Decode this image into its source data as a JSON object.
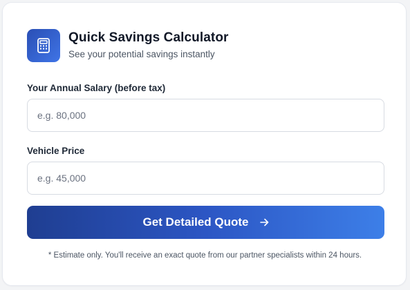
{
  "header": {
    "title": "Quick Savings Calculator",
    "subtitle": "See your potential savings instantly",
    "icon": "calculator-icon"
  },
  "form": {
    "salary": {
      "label": "Your Annual Salary (before tax)",
      "placeholder": "e.g. 80,000",
      "value": ""
    },
    "vehicle_price": {
      "label": "Vehicle Price",
      "placeholder": "e.g. 45,000",
      "value": ""
    }
  },
  "cta": {
    "label": "Get Detailed Quote",
    "icon": "arrow-right-icon"
  },
  "disclaimer": "* Estimate only. You'll receive an exact quote from our partner specialists within 24 hours.",
  "colors": {
    "accent_start": "#1f3e91",
    "accent_end": "#3d7fe8",
    "title": "#111827",
    "muted": "#4b5563"
  }
}
